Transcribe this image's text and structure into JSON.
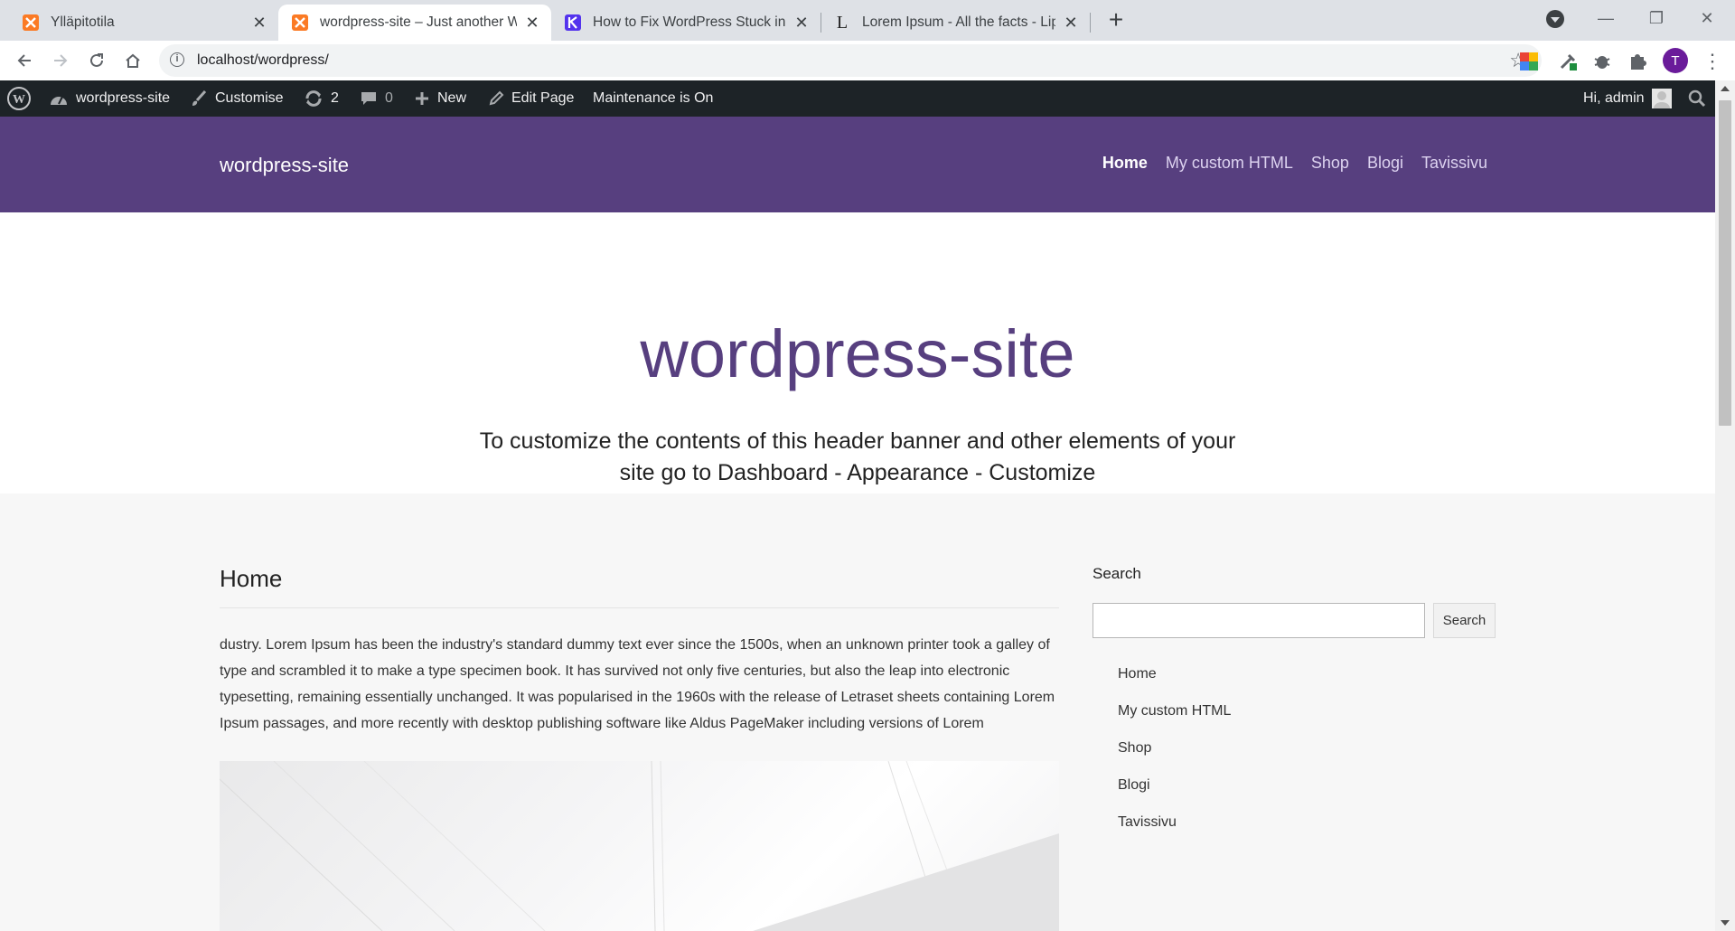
{
  "browser": {
    "tabs": [
      {
        "title": "Ylläpitotila",
        "icon": "xampp-icon"
      },
      {
        "title": "wordpress-site – Just another WordPress site",
        "icon": "xampp-icon",
        "active": true
      },
      {
        "title": "How to Fix WordPress Stuck in Maintenance Mode",
        "icon": "kinsta-icon"
      },
      {
        "title": "Lorem Ipsum - All the facts - Lipsum generator",
        "icon": "lipsum-icon"
      }
    ],
    "url": "localhost/wordpress/",
    "profile_initial": "T"
  },
  "adminbar": {
    "site_name": "wordpress-site",
    "customise": "Customise",
    "updates_count": "2",
    "comments_count": "0",
    "new": "New",
    "edit_page": "Edit Page",
    "maintenance": "Maintenance is On",
    "greeting": "Hi, admin"
  },
  "site": {
    "title": "wordpress-site",
    "nav": [
      "Home",
      "My custom HTML",
      "Shop",
      "Blogi",
      "Tavissivu"
    ]
  },
  "banner": {
    "title": "wordpress-site",
    "subtitle": "To customize the contents of this header banner and other elements of your site go to Dashboard - Appearance - Customize"
  },
  "page": {
    "title": "Home",
    "body": "dustry. Lorem Ipsum has been the industry's standard dummy text ever since the 1500s, when an unknown printer took a galley of type and scrambled it to make a type specimen book. It has survived not only five centuries, but also the leap into electronic typesetting, remaining essentially unchanged. It was popularised in the 1960s with the release of Letraset sheets containing Lorem Ipsum passages, and more recently with desktop publishing software like Aldus PageMaker including versions of Lorem"
  },
  "sidebar": {
    "search_title": "Search",
    "search_button": "Search",
    "links": [
      "Home",
      "My custom HTML",
      "Shop",
      "Blogi",
      "Tavissivu"
    ]
  },
  "colors": {
    "brand_purple": "#573f7f",
    "adminbar": "#1d2327"
  }
}
